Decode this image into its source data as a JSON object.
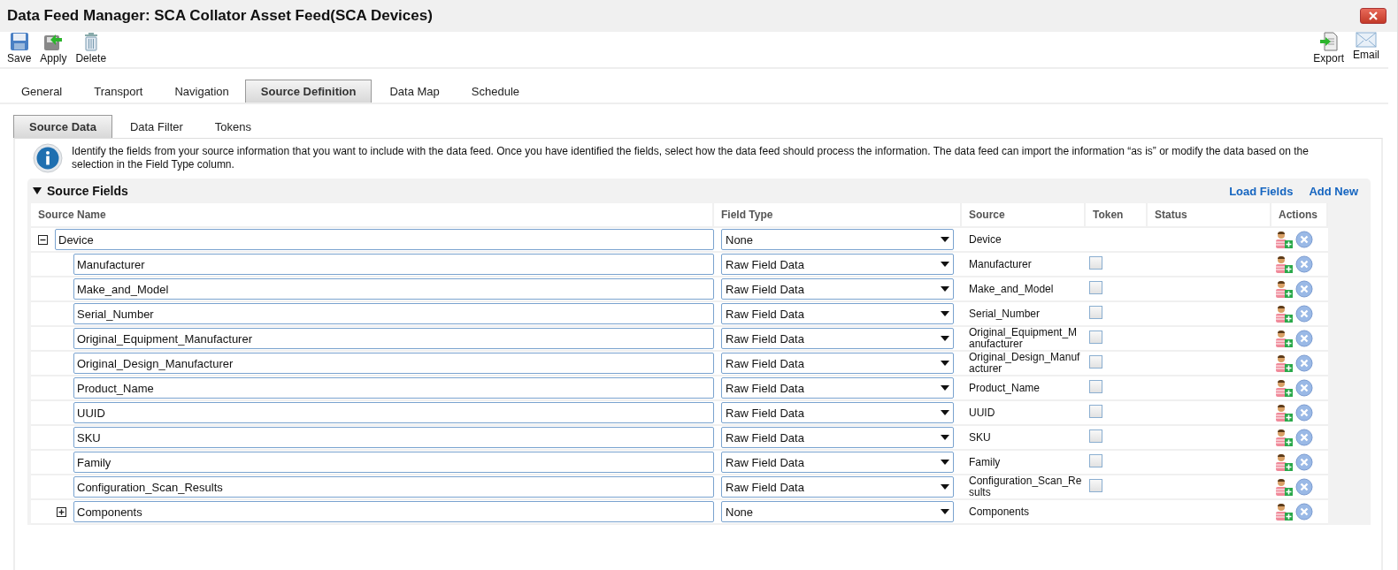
{
  "window": {
    "title": "Data Feed Manager: SCA Collator Asset Feed(SCA Devices)"
  },
  "toolbar": {
    "left": [
      {
        "label": "Save",
        "kind": "save"
      },
      {
        "label": "Apply",
        "kind": "apply"
      },
      {
        "label": "Delete",
        "kind": "delete"
      }
    ],
    "right": [
      {
        "label": "Export",
        "kind": "export"
      },
      {
        "label": "Email",
        "kind": "email"
      }
    ]
  },
  "tabs": [
    {
      "label": "General",
      "selected": false
    },
    {
      "label": "Transport",
      "selected": false
    },
    {
      "label": "Navigation",
      "selected": false
    },
    {
      "label": "Source Definition",
      "selected": true
    },
    {
      "label": "Data Map",
      "selected": false
    },
    {
      "label": "Schedule",
      "selected": false
    }
  ],
  "subtabs": [
    {
      "label": "Source Data",
      "selected": true
    },
    {
      "label": "Data Filter",
      "selected": false
    },
    {
      "label": "Tokens",
      "selected": false
    }
  ],
  "info": "Identify the fields from your source information that you want to include with the data feed. Once you have identified the fields, select how the data feed should process the information. The data feed can import the information “as is” or modify the data based on the selection in the Field Type column.",
  "section": {
    "title": "Source Fields",
    "expanded": true,
    "links": [
      "Load Fields",
      "Add New"
    ]
  },
  "table": {
    "columns": [
      "Source Name",
      "Field Type",
      "Source",
      "Token",
      "Status",
      "Actions"
    ],
    "rows": [
      {
        "name": "Device",
        "field_type": "None",
        "source": "Device",
        "expanded": true,
        "children": [
          {
            "name": "Manufacturer",
            "field_type": "Raw Field Data",
            "source": "Manufacturer",
            "checked": false
          },
          {
            "name": "Make_and_Model",
            "field_type": "Raw Field Data",
            "source": "Make_and_Model",
            "checked": false
          },
          {
            "name": "Serial_Number",
            "field_type": "Raw Field Data",
            "source": "Serial_Number",
            "checked": false
          },
          {
            "name": "Original_Equipment_Manufacturer",
            "field_type": "Raw Field Data",
            "source": "Original_Equipment_Manufacturer",
            "checked": false
          },
          {
            "name": "Original_Design_Manufacturer",
            "field_type": "Raw Field Data",
            "source": "Original_Design_Manufacturer",
            "checked": false
          },
          {
            "name": "Product_Name",
            "field_type": "Raw Field Data",
            "source": "Product_Name",
            "checked": false
          },
          {
            "name": "UUID",
            "field_type": "Raw Field Data",
            "source": "UUID",
            "checked": false
          },
          {
            "name": "SKU",
            "field_type": "Raw Field Data",
            "source": "SKU",
            "checked": false
          },
          {
            "name": "Family",
            "field_type": "Raw Field Data",
            "source": "Family",
            "checked": false
          },
          {
            "name": "Configuration_Scan_Results",
            "field_type": "Raw Field Data",
            "source": "Configuration_Scan_Results",
            "checked": false
          },
          {
            "name": "Components",
            "field_type": "None",
            "source": "Components",
            "expanded": false
          }
        ]
      }
    ]
  }
}
